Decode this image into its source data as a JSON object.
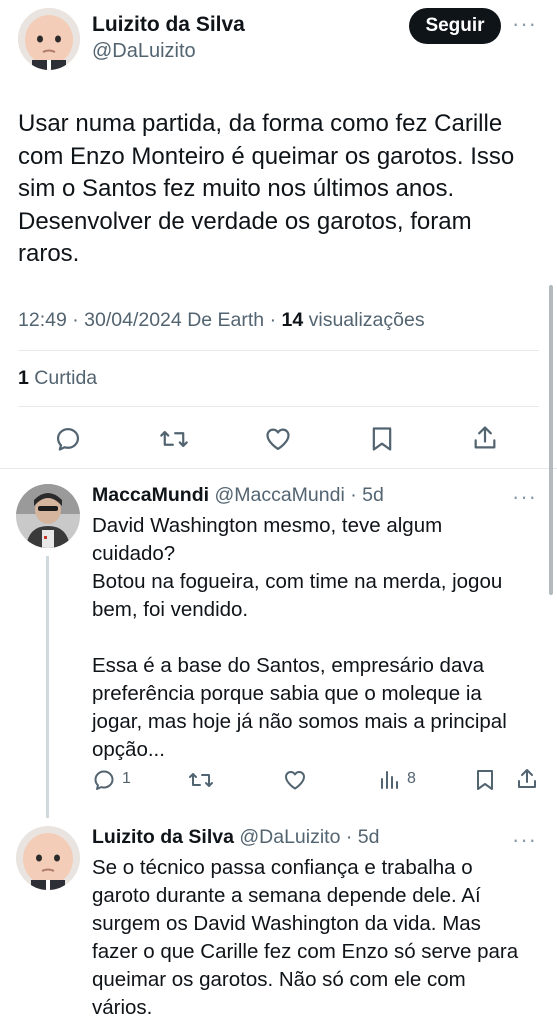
{
  "main_tweet": {
    "author_name": "Luizito da Silva",
    "author_handle": "@DaLuizito",
    "follow_label": "Seguir",
    "text": "Usar numa partida, da forma como fez Carille com Enzo Monteiro é queimar os garotos. Isso sim o Santos fez muito nos últimos anos. Desenvolver de verdade os garotos, foram raros.",
    "lines": [
      "Usar numa partida, da forma como fez Carille",
      "com Enzo Monteiro é queimar os garotos. Isso",
      "sim o Santos fez muito nos últimos anos.",
      "Desenvolver de verdade os garotos, foram",
      "raros."
    ],
    "time": "12:49",
    "date": "30/04/2024",
    "source": "De Earth",
    "views_count": "14",
    "views_label": "visualizações",
    "likes_count": "1",
    "likes_label": "Curtida"
  },
  "replies": [
    {
      "author_name": "MaccaMundi",
      "author_handle": "@MaccaMundi",
      "age": "5d",
      "lines": [
        "David Washington mesmo, teve algum",
        "cuidado?",
        "Botou na fogueira, com time na merda, jogou",
        "bem, foi vendido.",
        "",
        "Essa é a base do Santos, empresário dava",
        "preferência porque sabia que o moleque ia",
        "jogar, mas hoje já não somos mais a principal",
        "opção..."
      ],
      "reply_count": "1",
      "views_count": "8"
    },
    {
      "author_name": "Luizito da Silva",
      "author_handle": "@DaLuizito",
      "age": "5d",
      "lines": [
        "Se o técnico passa confiança e trabalha o",
        "garoto durante a semana depende dele. Aí",
        "surgem os David Washington da vida. Mas",
        "fazer o que Carille fez com Enzo só serve para",
        "queimar os garotos. Não só com ele com",
        "vários."
      ]
    }
  ],
  "icons": {
    "reply": "reply-icon",
    "retweet": "retweet-icon",
    "like": "heart-icon",
    "bookmark": "bookmark-icon",
    "share": "share-icon",
    "views": "views-icon",
    "more": "more-icon"
  },
  "colors": {
    "text": "#0f1419",
    "muted": "#536471",
    "button_bg": "#0f1419",
    "divider": "#e7e9eb"
  }
}
